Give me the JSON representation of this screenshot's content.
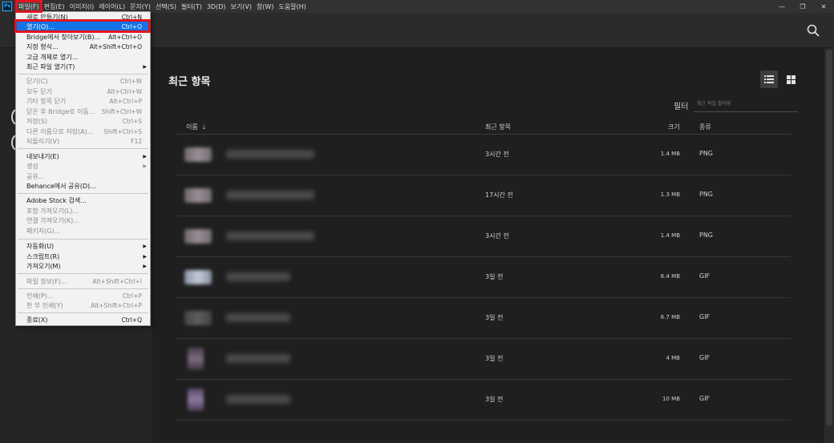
{
  "menubar": {
    "items": [
      "파일(F)",
      "편집(E)",
      "이미지(I)",
      "레이어(L)",
      "문자(Y)",
      "선택(S)",
      "필터(T)",
      "3D(D)",
      "보기(V)",
      "창(W)",
      "도움말(H)"
    ],
    "app_icon": "Ps",
    "win_minimize": "—",
    "win_restore": "❐",
    "win_close": "✕"
  },
  "topbar": {
    "search_icon": "search-icon"
  },
  "main": {
    "title": "최근 항목",
    "filter_label": "필터",
    "filter_placeholder": "최근 파일 필터링",
    "columns": {
      "name": "이름",
      "recent": "최근 항목",
      "size": "크기",
      "type": "종류"
    },
    "rows": [
      {
        "time": "3시간 전",
        "size": "1.4 MB",
        "type": "PNG"
      },
      {
        "time": "17시간 전",
        "size": "1.3 MB",
        "type": "PNG"
      },
      {
        "time": "3시간 전",
        "size": "1.4 MB",
        "type": "PNG"
      },
      {
        "time": "3일 전",
        "size": "6.4 MB",
        "type": "GIF"
      },
      {
        "time": "3일 전",
        "size": "6.7 MB",
        "type": "GIF"
      },
      {
        "time": "3일 전",
        "size": "4 MB",
        "type": "GIF"
      },
      {
        "time": "3일 전",
        "size": "10 MB",
        "type": "GIF"
      }
    ]
  },
  "file_menu": {
    "items": [
      {
        "label": "새로 만들기(N)",
        "shortcut": "Ctrl+N"
      },
      {
        "label": "열기(O)...",
        "shortcut": "Ctrl+O"
      },
      {
        "label": "Bridge에서 찾아보기(B)...",
        "shortcut": "Alt+Ctrl+O"
      },
      {
        "label": "지정 형식...",
        "shortcut": "Alt+Shift+Ctrl+O"
      },
      {
        "label": "고급 개체로 열기...",
        "shortcut": ""
      },
      {
        "label": "최근 파일 열기(T)",
        "shortcut": ""
      },
      {
        "label": "닫기(C)",
        "shortcut": "Ctrl+W"
      },
      {
        "label": "모두 닫기",
        "shortcut": "Alt+Ctrl+W"
      },
      {
        "label": "기타 항목 닫기",
        "shortcut": "Alt+Ctrl+P"
      },
      {
        "label": "닫은 후 Bridge로 이동...",
        "shortcut": "Shift+Ctrl+W"
      },
      {
        "label": "저장(S)",
        "shortcut": "Ctrl+S"
      },
      {
        "label": "다른 이름으로 저장(A)...",
        "shortcut": "Shift+Ctrl+S"
      },
      {
        "label": "되돌리기(V)",
        "shortcut": "F12"
      },
      {
        "label": "내보내기(E)",
        "shortcut": ""
      },
      {
        "label": "생성",
        "shortcut": ""
      },
      {
        "label": "공유...",
        "shortcut": ""
      },
      {
        "label": "Behance에서 공유(D)...",
        "shortcut": ""
      },
      {
        "label": "Adobe Stock 검색...",
        "shortcut": ""
      },
      {
        "label": "포함 가져오기(L)...",
        "shortcut": ""
      },
      {
        "label": "연결 가져오기(K)...",
        "shortcut": ""
      },
      {
        "label": "패키지(G)...",
        "shortcut": ""
      },
      {
        "label": "자동화(U)",
        "shortcut": ""
      },
      {
        "label": "스크립트(R)",
        "shortcut": ""
      },
      {
        "label": "가져오기(M)",
        "shortcut": ""
      },
      {
        "label": "파일 정보(F)...",
        "shortcut": "Alt+Shift+Ctrl+I"
      },
      {
        "label": "인쇄(P)...",
        "shortcut": "Ctrl+P"
      },
      {
        "label": "한 부 인쇄(Y)",
        "shortcut": "Alt+Shift+Ctrl+P"
      },
      {
        "label": "종료(X)",
        "shortcut": "Ctrl+Q"
      }
    ],
    "submenu_arrow": "▶"
  }
}
